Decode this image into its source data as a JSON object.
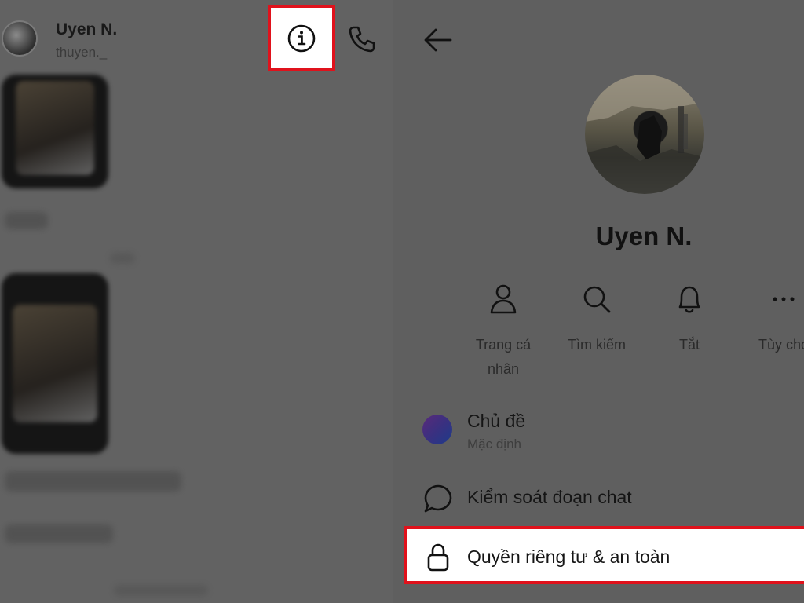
{
  "chat_header": {
    "name": "Uyen N.",
    "username": "thuyen._"
  },
  "icons": {
    "info": "info-icon",
    "call": "phone-icon",
    "back": "back-arrow-icon"
  },
  "profile": {
    "name": "Uyen N."
  },
  "actions": [
    {
      "label": "Trang cá\nnhân",
      "icon": "person-icon"
    },
    {
      "label": "Tìm kiếm",
      "icon": "search-icon"
    },
    {
      "label": "Tắt",
      "icon": "bell-icon"
    },
    {
      "label": "Tùy chọ",
      "icon": "more-icon"
    }
  ],
  "menu": {
    "theme_title": "Chủ đề",
    "theme_value": "Mặc định",
    "chat_control": "Kiểm soát đoạn chat",
    "privacy": "Quyền riêng tư & an toàn"
  },
  "colors": {
    "overlay": "#5f5f5f",
    "highlight": "#e0121c",
    "highlight_bg": "#ffffff"
  }
}
